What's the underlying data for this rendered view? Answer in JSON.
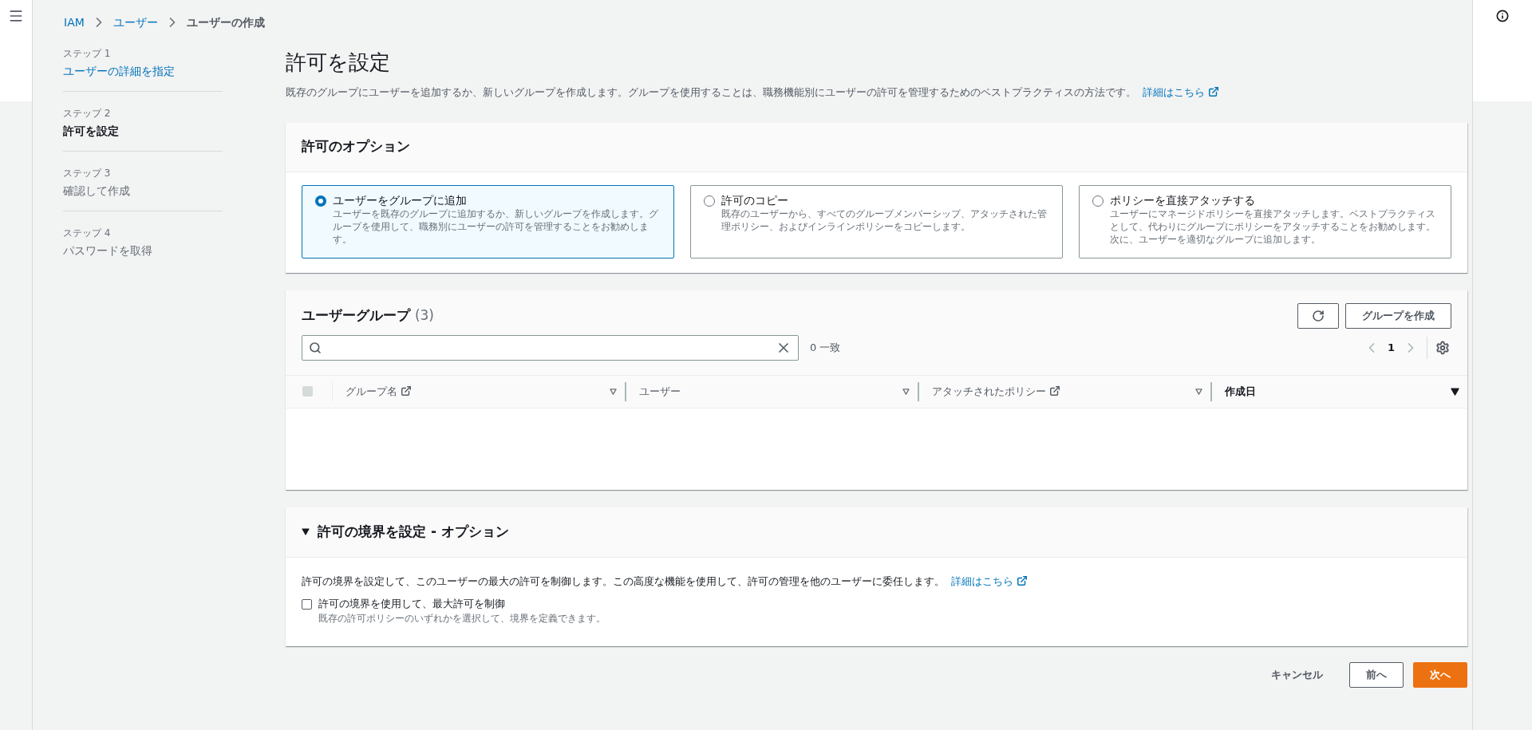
{
  "breadcrumbs": [
    {
      "label": "IAM",
      "kind": "link"
    },
    {
      "label": "ユーザー",
      "kind": "link"
    },
    {
      "label": "ユーザーの作成",
      "kind": "current"
    }
  ],
  "steps": [
    {
      "step": "ステップ 1",
      "title": "ユーザーの詳細を指定",
      "kind": "done"
    },
    {
      "step": "ステップ 2",
      "title": "許可を設定",
      "kind": "current"
    },
    {
      "step": "ステップ 3",
      "title": "確認して作成",
      "kind": "todo"
    },
    {
      "step": "ステップ 4",
      "title": "パスワードを取得",
      "kind": "todo"
    }
  ],
  "page": {
    "title": "許可を設定",
    "description": "既存のグループにユーザーを追加するか、新しいグループを作成します。グループを使用することは、職務機能別にユーザーの許可を管理するためのベストプラクティスの方法です。",
    "learn_more": "詳細はこちら"
  },
  "permission_options": {
    "title": "許可のオプション",
    "options": [
      {
        "label": "ユーザーをグループに追加",
        "description": "ユーザーを既存のグループに追加するか、新しいグループを作成します。グループを使用して、職務別にユーザーの許可を管理することをお勧めします。",
        "selected": true
      },
      {
        "label": "許可のコピー",
        "description": "既存のユーザーから、すべてのグループメンバーシップ、アタッチされた管理ポリシー、およびインラインポリシーをコピーします。",
        "selected": false
      },
      {
        "label": "ポリシーを直接アタッチする",
        "description": "ユーザーにマネージドポリシーを直接アタッチします。ベストプラクティスとして、代わりにグループにポリシーをアタッチすることをお勧めします。次に、ユーザーを適切なグループに追加します。",
        "selected": false
      }
    ]
  },
  "user_groups": {
    "title": "ユーザーグループ",
    "count": "(3)",
    "create_button": "グループを作成",
    "match_count": "0 一致",
    "page": "1",
    "select_all_checked": false,
    "columns": [
      {
        "label": "グループ名",
        "external": true,
        "sorted": false
      },
      {
        "label": "ユーザー",
        "external": false,
        "sorted": false
      },
      {
        "label": "アタッチされたポリシー",
        "external": true,
        "sorted": false
      },
      {
        "label": "作成日",
        "external": false,
        "sorted": true
      }
    ]
  },
  "boundary": {
    "title": "許可の境界を設定 - オプション",
    "expanded": true,
    "description": "許可の境界を設定して、このユーザーの最大の許可を制御します。この高度な機能を使用して、許可の管理を他のユーザーに委任します。",
    "learn_more": "詳細はこちら",
    "checkbox": {
      "label": "許可の境界を使用して、最大許可を制御",
      "description": "既存の許可ポリシーのいずれかを選択して、境界を定義できます。",
      "checked": false
    }
  },
  "footer_buttons": [
    {
      "label": "キャンセル",
      "kind": "link"
    },
    {
      "label": "前へ",
      "kind": "normal"
    },
    {
      "label": "次へ",
      "kind": "primary"
    }
  ]
}
